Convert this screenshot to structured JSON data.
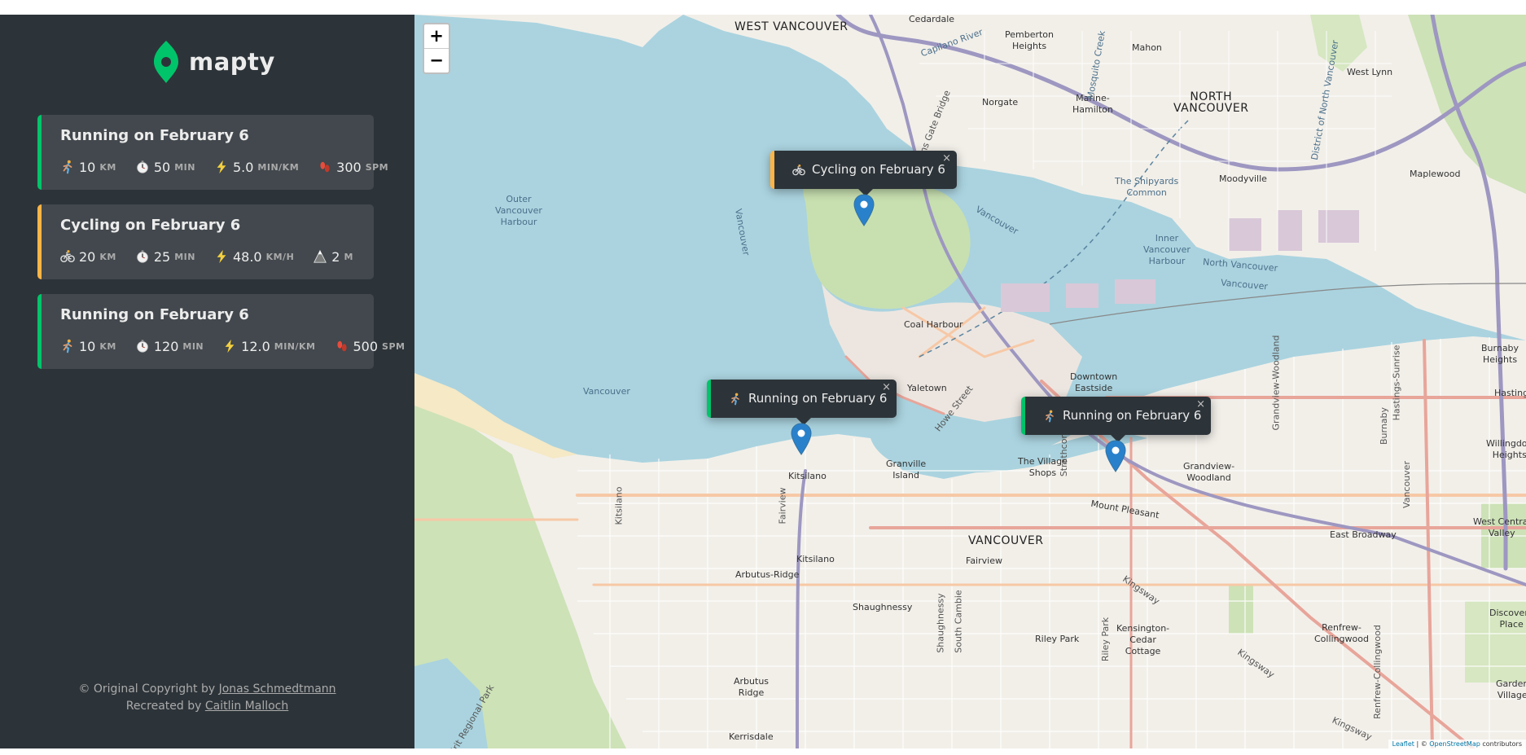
{
  "app": {
    "name": "mapty"
  },
  "colors": {
    "running": "#00c46a",
    "cycling": "#ffb545",
    "sidebar": "#2d3439",
    "card": "#42484d"
  },
  "workouts": [
    {
      "type": "running",
      "title": "Running on February 6",
      "details": [
        {
          "icon": "runner-icon",
          "value": "10",
          "unit": "KM"
        },
        {
          "icon": "stopwatch-icon",
          "value": "50",
          "unit": "MIN"
        },
        {
          "icon": "lightning-icon",
          "value": "5.0",
          "unit": "MIN/KM"
        },
        {
          "icon": "footprints-icon",
          "value": "300",
          "unit": "SPM"
        }
      ]
    },
    {
      "type": "cycling",
      "title": "Cycling on February 6",
      "details": [
        {
          "icon": "bicycle-icon",
          "value": "20",
          "unit": "KM"
        },
        {
          "icon": "stopwatch-icon",
          "value": "25",
          "unit": "MIN"
        },
        {
          "icon": "lightning-icon",
          "value": "48.0",
          "unit": "KM/H"
        },
        {
          "icon": "mountain-icon",
          "value": "2",
          "unit": "M"
        }
      ]
    },
    {
      "type": "running",
      "title": "Running on February 6",
      "details": [
        {
          "icon": "runner-icon",
          "value": "10",
          "unit": "KM"
        },
        {
          "icon": "stopwatch-icon",
          "value": "120",
          "unit": "MIN"
        },
        {
          "icon": "lightning-icon",
          "value": "12.0",
          "unit": "MIN/KM"
        },
        {
          "icon": "footprints-icon",
          "value": "500",
          "unit": "SPM"
        }
      ]
    }
  ],
  "footer": {
    "line1_prefix": "© Original Copyright by ",
    "line1_link": "Jonas Schmedtmann",
    "line2_prefix": "Recreated by ",
    "line2_link": "Caitlin Malloch"
  },
  "map": {
    "zoom_in": "+",
    "zoom_out": "−",
    "popups": [
      {
        "type": "cycling",
        "icon": "bicycle-icon",
        "text": "Cycling on February 6",
        "close": "×"
      },
      {
        "type": "running",
        "icon": "runner-icon",
        "text": "Running on February 6",
        "close": "×"
      },
      {
        "type": "running",
        "icon": "runner-icon",
        "text": "Running on February 6",
        "close": "×"
      }
    ],
    "labels": {
      "west_vancouver": "WEST VANCOUVER",
      "cedardale": "Cedardale",
      "pemberton_heights": "Pemberton\nHeights",
      "mahon": "Mahon",
      "west_lynn": "West Lynn",
      "norgate": "Norgate",
      "marine_hamilton": "Marine-\nHamilton",
      "north_vancouver": "NORTH\nVANCOUVER",
      "district_north_vancouver": "District of North Vancouver",
      "lions_gate_bridge": "Lions Gate Bridge",
      "capilano_river": "Capilano River",
      "mosquito_creek": "Mosquito Creek",
      "outer_harbour": "Outer\nVancouver\nHarbour",
      "vancouver_park": "Vancouver",
      "vancouver_water1": "Vancouver",
      "shipyards": "The Shipyards\nCommon",
      "moodyville": "Moodyville",
      "maplewood": "Maplewood",
      "inner_harbour": "Inner\nVancouver\nHarbour",
      "north_vancouver_water": "North Vancouver",
      "vancouver_water2": "Vancouver",
      "coal_harbour": "Coal Harbour",
      "vancouver_bay": "Vancouver",
      "yaletown": "Yaletown",
      "howe_street": "Howe Street",
      "downtown_eastside": "Downtown\nEastside",
      "grandview_woodland_st": "Grandview-Woodland",
      "hastings_sunrise": "Hastings-Sunrise",
      "burnaby_heights": "Burnaby\nHeights",
      "hastings": "Hastings",
      "burnaby": "Burnaby",
      "willingdon_heights": "Willingdon\nHeights",
      "kitsilano1": "Kitsilano",
      "granville_island": "Granville\nIsland",
      "village_shops": "The Village\nShops",
      "grandview_woodland": "Grandview-\nWoodland",
      "strathcona": "Strathcona",
      "mount_pleasant": "Mount Pleasant",
      "vancouver_city": "VANCOUVER",
      "fairview1": "Fairview",
      "fairview2": "Fairview",
      "east_broadway": "East Broadway",
      "west_central_valley": "West Central\nValley",
      "kitsilano_st": "Kitsilano",
      "kitsilano2": "Kitsilano",
      "arbutus_ridge": "Arbutus-Ridge",
      "shaughnessy": "Shaughnessy",
      "shaughnessy_st": "Shaughnessy",
      "south_cambie": "South Cambie",
      "riley_park": "Riley Park",
      "riley_park_st": "Riley Park",
      "kensington": "Kensington-\nCedar\nCottage",
      "kingsway1": "Kingsway",
      "kingsway2": "Kingsway",
      "kingsway3": "Kingsway",
      "renfrew": "Renfrew-\nCollingwood",
      "renfrew_collingwood_st": "Renfrew-Collingwood",
      "vancouver_east": "Vancouver",
      "discovery_place": "Discovery\nPlace",
      "garden_village": "Garden\nVillage",
      "arbutus_ridge2": "Arbutus\nRidge",
      "kerrisdale": "Kerrisdale",
      "pacific_spirit": "Pacific Spirit Regional Park"
    },
    "attribution_prefix": "Leaflet",
    "attribution_mid": " | © ",
    "attribution_link": "OpenStreetMap",
    "attribution_suffix": " contributors"
  }
}
